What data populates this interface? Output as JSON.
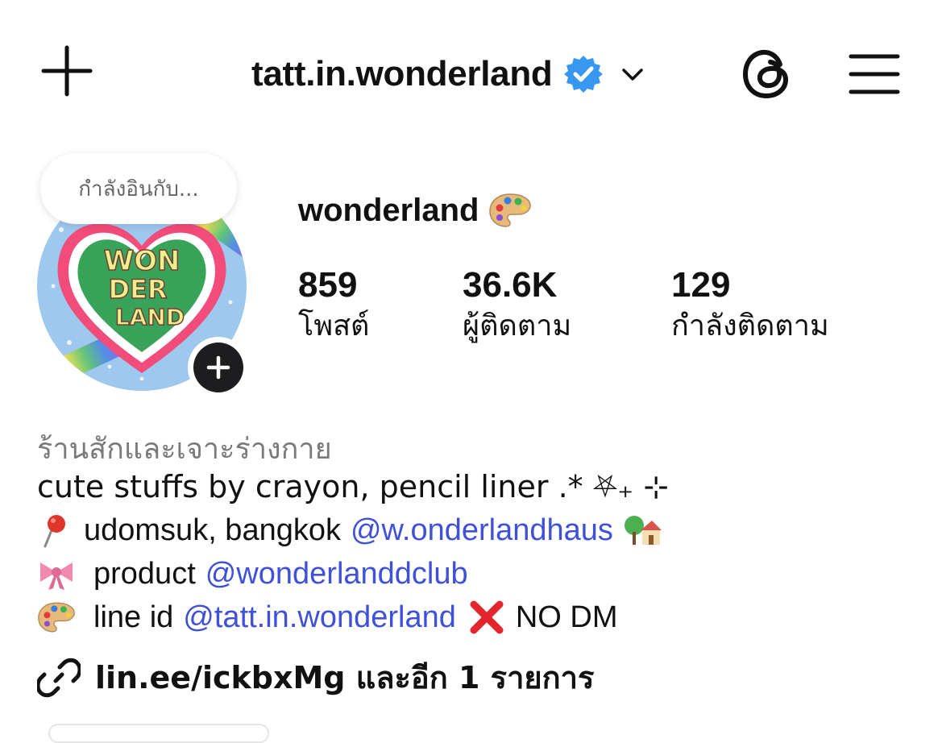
{
  "header": {
    "username": "tatt.in.wonderland",
    "verified": true,
    "icons": [
      "plus-icon",
      "verified-badge-icon",
      "chevron-down-icon",
      "threads-icon",
      "menu-icon"
    ]
  },
  "profile": {
    "note": "กำลังอินกับ...",
    "display_name": "wonderland",
    "display_name_emoji": "artist-palette",
    "avatar_text": "WONDERLAND",
    "stats": [
      {
        "value": "859",
        "label": "โพสต์"
      },
      {
        "value": "36.6K",
        "label": "ผู้ติดตาม"
      },
      {
        "value": "129",
        "label": "กำลังติดตาม"
      }
    ]
  },
  "bio": {
    "category": "ร้านสักและเจาะร่างกาย",
    "line1": "cute stuffs by crayon, pencil liner .* ⛧₊ ⊹",
    "line2_text": "udomsuk, bangkok",
    "line2_mention": "@w.onderlandhaus",
    "line3_text": "product",
    "line3_mention": "@wonderlanddclub",
    "line4_text": "line id",
    "line4_mention": "@tatt.in.wonderland",
    "line4_suffix": "NO DM",
    "link": "lin.ee/ickbxMg และอีก 1 รายการ"
  },
  "colors": {
    "mention": "#3f51d8",
    "verified": "#3897f0",
    "text": "#111111",
    "muted": "#7a7a7a"
  }
}
